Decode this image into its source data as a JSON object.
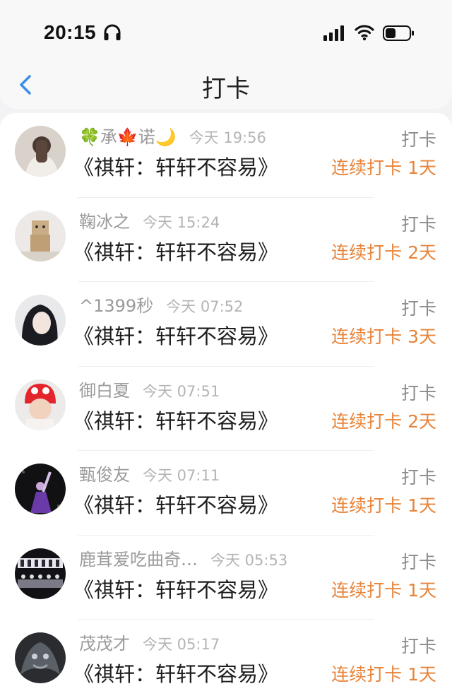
{
  "status_bar": {
    "time": "20:15"
  },
  "header": {
    "title": "打卡",
    "back_icon": "chevron-left-icon"
  },
  "colors": {
    "accent_blue": "#3a8ee6",
    "streak_orange": "#e8843a",
    "meta_gray": "#9a9a9a"
  },
  "entries": [
    {
      "user": "🍀承🍁诺🌙",
      "time": "今天 19:56",
      "title": "《祺轩：轩轩不容易》",
      "action": "打卡",
      "streak": "连续打卡 1天"
    },
    {
      "user": "鞠冰之",
      "time": "今天 15:24",
      "title": "《祺轩：轩轩不容易》",
      "action": "打卡",
      "streak": "连续打卡 2天"
    },
    {
      "user": "^1399秒",
      "time": "今天 07:52",
      "title": "《祺轩：轩轩不容易》",
      "action": "打卡",
      "streak": "连续打卡 3天"
    },
    {
      "user": "御白夏",
      "time": "今天 07:51",
      "title": "《祺轩：轩轩不容易》",
      "action": "打卡",
      "streak": "连续打卡 2天"
    },
    {
      "user": "甄俊友",
      "time": "今天 07:11",
      "title": "《祺轩：轩轩不容易》",
      "action": "打卡",
      "streak": "连续打卡 1天"
    },
    {
      "user": "鹿茸爱吃曲奇…",
      "time": "今天 05:53",
      "title": "《祺轩：轩轩不容易》",
      "action": "打卡",
      "streak": "连续打卡 1天"
    },
    {
      "user": "茂茂才",
      "time": "今天 05:17",
      "title": "《祺轩：轩轩不容易》",
      "action": "打卡",
      "streak": "连续打卡 1天"
    }
  ]
}
